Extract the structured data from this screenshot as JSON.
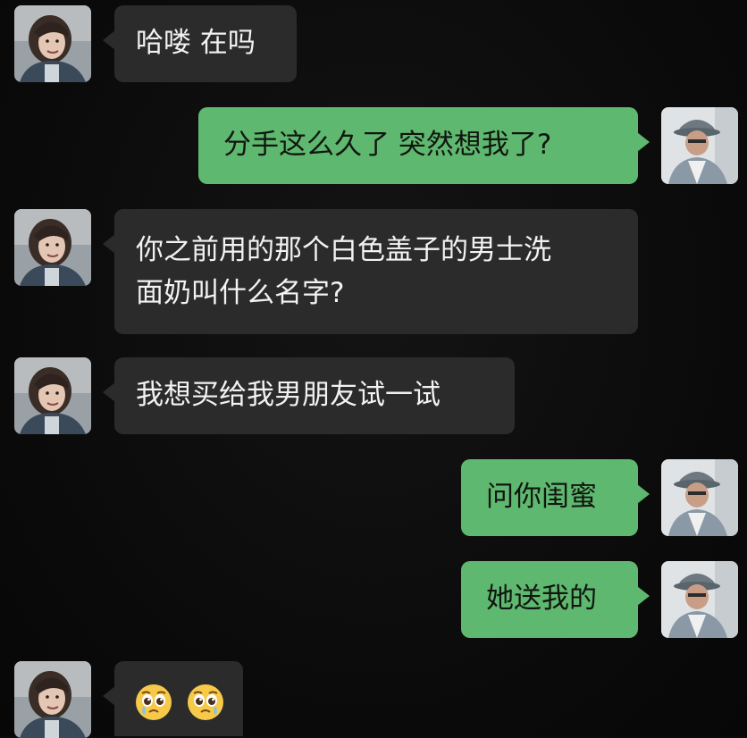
{
  "messages": [
    {
      "side": "left",
      "lines": [
        "哈喽 在吗"
      ]
    },
    {
      "side": "right",
      "lines": [
        "分手这么久了  突然想我了?"
      ]
    },
    {
      "side": "left",
      "lines": [
        "你之前用的那个白色盖子的男士洗",
        "面奶叫什么名字?"
      ]
    },
    {
      "side": "left",
      "lines": [
        "我想买给我男朋友试一试"
      ]
    },
    {
      "side": "right",
      "lines": [
        "问你闺蜜"
      ]
    },
    {
      "side": "right",
      "lines": [
        "她送我的"
      ]
    },
    {
      "side": "left",
      "emoji": [
        "pleading-face-icon",
        "pleading-face-icon"
      ]
    }
  ],
  "colors": {
    "background": "#0b0b0b",
    "incoming_bubble": "#2b2b2b",
    "outgoing_bubble": "#5fb86f"
  },
  "icons": {
    "female_avatar": "girl-avatar-icon",
    "male_avatar": "man-with-hat-avatar-icon"
  }
}
